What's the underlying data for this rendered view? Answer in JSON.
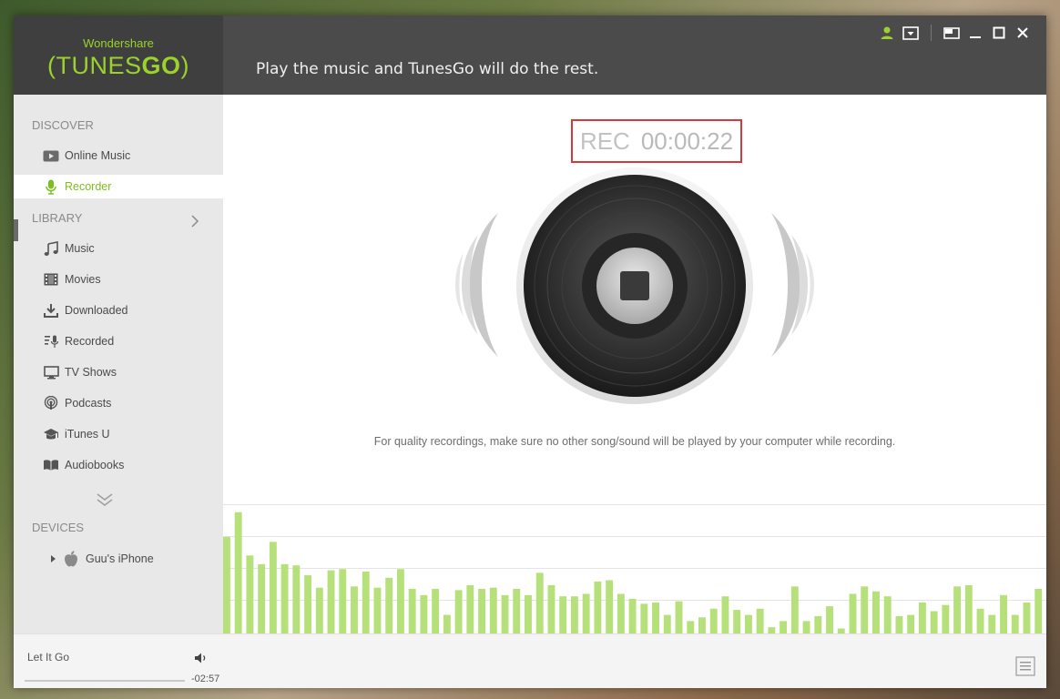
{
  "app": {
    "brand_top": "Wondershare",
    "brand_name_light": "TUNES",
    "brand_name_bold": "GO",
    "tagline": "Play the music and TunesGo will do the rest."
  },
  "window_controls": [
    "user-icon",
    "dropdown-icon",
    "mini-mode-icon",
    "minimize-icon",
    "maximize-icon",
    "close-icon"
  ],
  "sidebar": {
    "discover_header": "DISCOVER",
    "discover_items": [
      {
        "label": "Online Music",
        "icon": "play-icon"
      },
      {
        "label": "Recorder",
        "icon": "microphone-icon",
        "active": true
      }
    ],
    "library_header": "LIBRARY",
    "library_items": [
      {
        "label": "Music",
        "icon": "music-note-icon"
      },
      {
        "label": "Movies",
        "icon": "film-icon"
      },
      {
        "label": "Downloaded",
        "icon": "download-icon"
      },
      {
        "label": "Recorded",
        "icon": "recorded-icon"
      },
      {
        "label": "TV Shows",
        "icon": "tv-icon"
      },
      {
        "label": "Podcasts",
        "icon": "podcast-icon"
      },
      {
        "label": "iTunes U",
        "icon": "graduation-cap-icon"
      },
      {
        "label": "Audiobooks",
        "icon": "book-icon"
      }
    ],
    "devices_header": "DEVICES",
    "devices": [
      {
        "label": "Guu's iPhone",
        "icon": "apple-icon"
      }
    ]
  },
  "recorder": {
    "rec_label": "REC",
    "time": "00:00:22",
    "hint": "For quality recordings, make sure no other song/sound will be played by your computer while recording."
  },
  "visualizer": {
    "color": "#b6e07a",
    "levels": [
      0.78,
      0.98,
      0.63,
      0.56,
      0.74,
      0.56,
      0.55,
      0.47,
      0.37,
      0.51,
      0.52,
      0.38,
      0.5,
      0.37,
      0.45,
      0.52,
      0.36,
      0.31,
      0.36,
      0.15,
      0.35,
      0.39,
      0.36,
      0.37,
      0.31,
      0.36,
      0.31,
      0.49,
      0.39,
      0.3,
      0.3,
      0.32,
      0.42,
      0.43,
      0.32,
      0.28,
      0.24,
      0.25,
      0.15,
      0.26,
      0.1,
      0.13,
      0.2,
      0.3,
      0.19,
      0.15,
      0.2,
      0.05,
      0.1,
      0.38,
      0.1,
      0.14,
      0.22,
      0.04,
      0.32,
      0.38,
      0.34,
      0.3,
      0.14,
      0.15,
      0.25,
      0.18,
      0.23,
      0.38,
      0.39,
      0.2,
      0.15,
      0.31,
      0.15,
      0.25,
      0.36
    ]
  },
  "player": {
    "song": "Let It Go",
    "remaining": "-02:57",
    "progress": 0
  }
}
